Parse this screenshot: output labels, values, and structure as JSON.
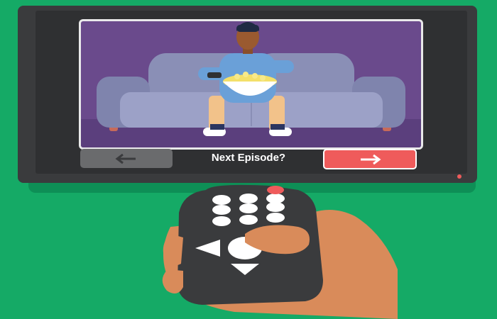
{
  "prompt": {
    "text": "Next Episode?"
  },
  "buttons": {
    "back_icon": "left-arrow",
    "next_icon": "right-arrow"
  },
  "colors": {
    "background": "#15aa66",
    "tv_body": "#3a3b3d",
    "screen": "#6a4a8c",
    "next_button": "#ef5b5b",
    "back_button": "#6a6b6d",
    "power_led": "#ef5b5b",
    "remote": "#3a3b3d",
    "hand": "#d98b5a"
  }
}
